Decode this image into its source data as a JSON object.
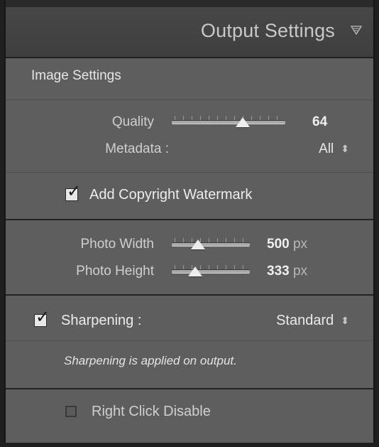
{
  "panel": {
    "title": "Output Settings",
    "collapse_icon": "triangle-down-icon"
  },
  "image_settings": {
    "heading": "Image Settings",
    "quality": {
      "label": "Quality",
      "value": "64",
      "level": 0.64
    },
    "metadata": {
      "label": "Metadata :",
      "value": "All"
    },
    "watermark": {
      "label": "Add Copyright Watermark",
      "checked": true
    }
  },
  "size": {
    "width": {
      "label": "Photo Width",
      "value": "500",
      "unit": "px",
      "level": 0.3
    },
    "height": {
      "label": "Photo Height",
      "value": "333",
      "unit": "px",
      "level": 0.25
    }
  },
  "sharpening": {
    "label": "Sharpening :",
    "checked": true,
    "value": "Standard",
    "note": "Sharpening is applied on output."
  },
  "right_click": {
    "label": "Right Click Disable",
    "checked": false
  }
}
